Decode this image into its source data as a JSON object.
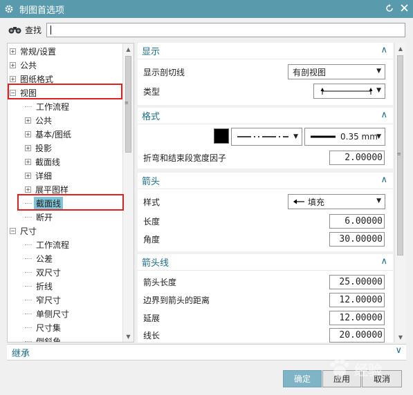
{
  "window": {
    "title": "制图首选项"
  },
  "find": {
    "label": "查找",
    "value": ""
  },
  "tree": {
    "items": [
      {
        "label": "常规/设置",
        "level": 0,
        "expander": "+"
      },
      {
        "label": "公共",
        "level": 0,
        "expander": "+"
      },
      {
        "label": "图纸格式",
        "level": 0,
        "expander": "+"
      },
      {
        "label": "视图",
        "level": 0,
        "expander": "-"
      },
      {
        "label": "工作流程",
        "level": 1,
        "expander": ""
      },
      {
        "label": "公共",
        "level": 1,
        "expander": "+"
      },
      {
        "label": "基本/图纸",
        "level": 1,
        "expander": "+"
      },
      {
        "label": "投影",
        "level": 1,
        "expander": "+"
      },
      {
        "label": "截面线",
        "level": 1,
        "expander": "+"
      },
      {
        "label": "详细",
        "level": 1,
        "expander": "+"
      },
      {
        "label": "展平图样",
        "level": 1,
        "expander": "+"
      },
      {
        "label": "截面线",
        "level": 1,
        "expander": "",
        "selected": true
      },
      {
        "label": "断开",
        "level": 1,
        "expander": ""
      },
      {
        "label": "尺寸",
        "level": 0,
        "expander": "-"
      },
      {
        "label": "工作流程",
        "level": 1,
        "expander": ""
      },
      {
        "label": "公差",
        "level": 1,
        "expander": ""
      },
      {
        "label": "双尺寸",
        "level": 1,
        "expander": ""
      },
      {
        "label": "折线",
        "level": 1,
        "expander": ""
      },
      {
        "label": "窄尺寸",
        "level": 1,
        "expander": ""
      },
      {
        "label": "单侧尺寸",
        "level": 1,
        "expander": ""
      },
      {
        "label": "尺寸集",
        "level": 1,
        "expander": ""
      },
      {
        "label": "倒斜角",
        "level": 1,
        "expander": ""
      }
    ]
  },
  "props": {
    "display": {
      "header": "显示",
      "show_section_line_label": "显示剖切线",
      "show_section_line_value": "有剖视图",
      "type_label": "类型"
    },
    "format": {
      "header": "格式",
      "line_width_value": "0.35 mm",
      "bend_factor_label": "折弯和结束段宽度因子",
      "bend_factor_value": "2.00000"
    },
    "arrowhead": {
      "header": "箭头",
      "style_label": "样式",
      "style_value": "填充",
      "length_label": "长度",
      "length_value": "6.00000",
      "angle_label": "角度",
      "angle_value": "30.00000"
    },
    "arrow_line": {
      "header": "箭头线",
      "arrow_length_label": "箭头长度",
      "arrow_length_value": "25.00000",
      "border_distance_label": "边界到箭头的距离",
      "border_distance_value": "12.00000",
      "extension_label": "延展",
      "extension_value": "12.00000",
      "line_length_label": "线长",
      "line_length_value": "20.00000"
    }
  },
  "inherit": {
    "label": "继承"
  },
  "buttons": {
    "ok": "确定",
    "apply": "应用",
    "cancel": "取消"
  },
  "watermark": {
    "text": "经验"
  },
  "colors": {
    "titlebar": "#5a9aad",
    "accent": "#1d6b86",
    "selection": "#7ec3d6",
    "highlight": "#e02020"
  }
}
